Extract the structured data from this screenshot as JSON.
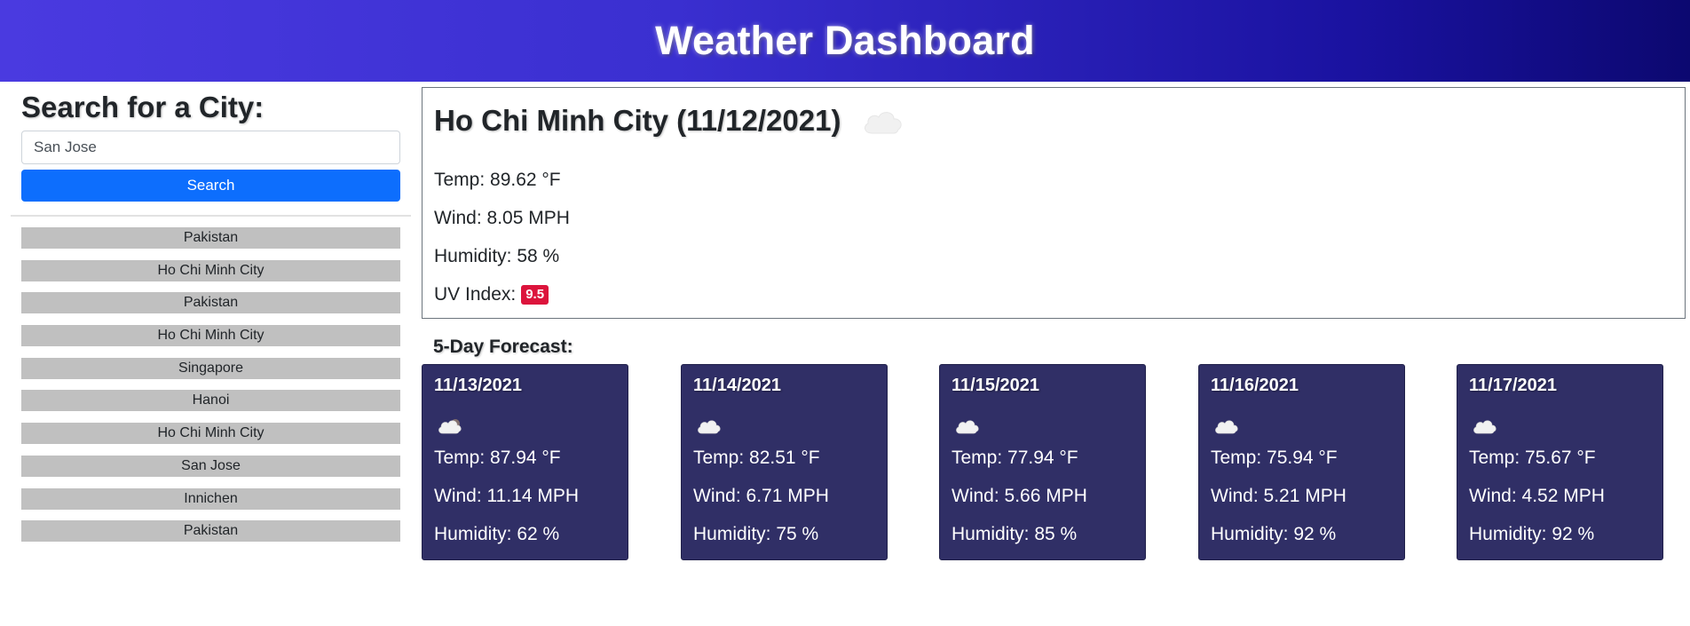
{
  "header": {
    "title": "Weather Dashboard"
  },
  "search": {
    "title": "Search for a City:",
    "input_value": "San Jose",
    "button_label": "Search"
  },
  "history": [
    "Pakistan",
    "Ho Chi Minh City",
    "Pakistan",
    "Ho Chi Minh City",
    "Singapore",
    "Hanoi",
    "Ho Chi Minh City",
    "San Jose",
    "Innichen",
    "Pakistan"
  ],
  "current": {
    "title": "Ho Chi Minh City (11/12/2021)",
    "icon": "cloud-icon",
    "temp": "Temp: 89.62 °F",
    "wind": "Wind: 8.05 MPH",
    "humidity": "Humidity: 58 %",
    "uv_label": "UV Index:",
    "uv_value": "9.5",
    "uv_color": "#dc143c"
  },
  "forecast": {
    "title": "5-Day Forecast:",
    "days": [
      {
        "date": "11/13/2021",
        "icon": "cloud-icon",
        "temp": "Temp: 87.94 °F",
        "wind": "Wind: 11.14 MPH",
        "humidity": "Humidity: 62 %"
      },
      {
        "date": "11/14/2021",
        "icon": "cloud-icon",
        "temp": "Temp: 82.51 °F",
        "wind": "Wind: 6.71 MPH",
        "humidity": "Humidity: 75 %"
      },
      {
        "date": "11/15/2021",
        "icon": "cloud-icon",
        "temp": "Temp: 77.94 °F",
        "wind": "Wind: 5.66 MPH",
        "humidity": "Humidity: 85 %"
      },
      {
        "date": "11/16/2021",
        "icon": "cloud-icon",
        "temp": "Temp: 75.94 °F",
        "wind": "Wind: 5.21 MPH",
        "humidity": "Humidity: 92 %"
      },
      {
        "date": "11/17/2021",
        "icon": "cloud-icon",
        "temp": "Temp: 75.67 °F",
        "wind": "Wind: 4.52 MPH",
        "humidity": "Humidity: 92 %"
      }
    ]
  },
  "colors": {
    "header_start": "#4a3ae0",
    "header_end": "#0c0870",
    "search_button": "#0d6efd",
    "history_button": "#c0c0c0",
    "forecast_card": "#302f66"
  }
}
